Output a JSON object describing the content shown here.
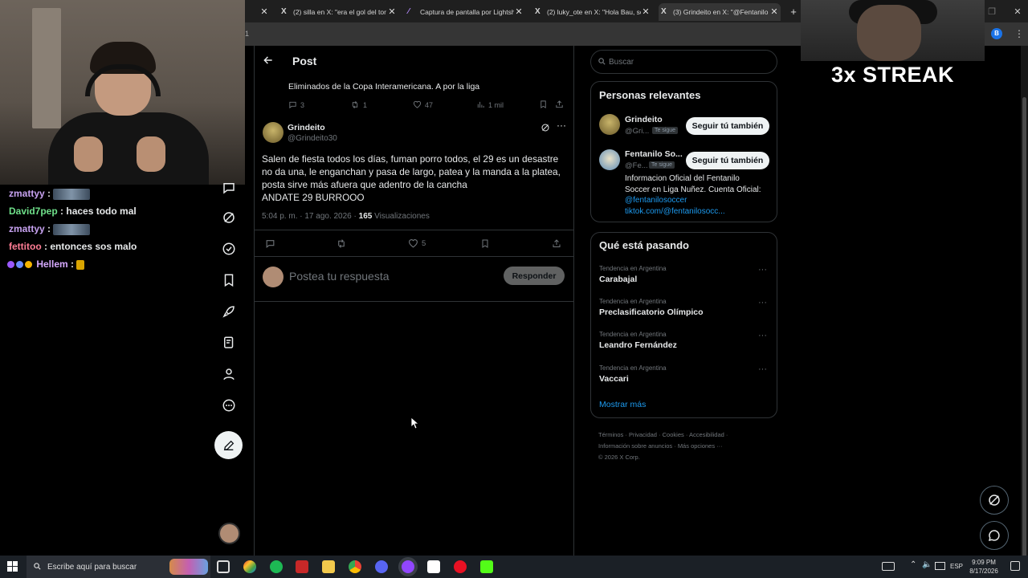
{
  "webcam": {
    "label": "Streamer webcam"
  },
  "chat": [
    {
      "user": "zmattyy",
      "color": "#c7a2f0",
      "message": "",
      "emote": "emote"
    },
    {
      "user": "David7pep",
      "color": "#6fe08a",
      "message": "haces todo mal"
    },
    {
      "user": "zmattyy",
      "color": "#c7a2f0",
      "message": "",
      "emote": "emote"
    },
    {
      "user": "fettitoo",
      "color": "#ff7d95",
      "message": "entonces sos malo"
    },
    {
      "user": "Hellem",
      "color": "#d6a9ff",
      "message": "",
      "badges": true
    }
  ],
  "browser": {
    "tabs": [
      {
        "title": "(2) silla en X: \"era el gol del tor"
      },
      {
        "title": "Captura de pantalla por Lightsh"
      },
      {
        "title": "(2) luky_ote en X: \"Hola Bau, so"
      },
      {
        "title": "(3) Grindeito en X: \"@Fentanilo"
      }
    ],
    "address_fragment": "1",
    "profile_initial": "B"
  },
  "overlay": {
    "streak": "3x STREAK"
  },
  "x": {
    "header_title": "Post",
    "parent_post": {
      "text": "Eliminados de la Copa Interamericana.  A por la liga",
      "replies": "3",
      "reposts": "1",
      "likes": "47",
      "views": "1 mil"
    },
    "post": {
      "author_name": "Grindeito",
      "author_handle": "@Grindeito30",
      "lines": [
        "Salen de fiesta todos los días, fuman porro todos, el 29 es un desastre",
        "no da una, le enganchan y pasa de largo, patea y la manda a la platea,",
        "posta sirve más afuera que adentro de la cancha",
        "ANDATE 29 BURROOO"
      ],
      "time": "5:04 p. m. · 17 ago. 2026 · ",
      "views_count": "165",
      "views_label": "Visualizaciones",
      "likes": "5"
    },
    "reply_placeholder": "Postea tu respuesta",
    "reply_button": "Responder",
    "search_placeholder": "Buscar",
    "relevant": {
      "title": "Personas relevantes",
      "people": [
        {
          "name": "Grindeito",
          "handle": "@Gri...",
          "follows_you": "Te sigue",
          "button": "Seguir tú también"
        },
        {
          "name": "Fentanilo So...",
          "handle": "@Fe...",
          "follows_you": "Te sigue",
          "button": "Seguir tú también",
          "bio1": "Informacion Oficial del Fentanilo",
          "bio2": "Soccer en Liga Nuñez. Cuenta Oficial:",
          "link1": "@fentanilosoccer",
          "link2": "tiktok.com/@fentanilosocc..."
        }
      ]
    },
    "trends": {
      "title": "Qué está pasando",
      "items": [
        {
          "context": "Tendencia en Argentina",
          "name": "Carabajal"
        },
        {
          "context": "Tendencia en Argentina",
          "name": "Preclasificatorio Olímpico"
        },
        {
          "context": "Tendencia en Argentina",
          "name": "Leandro Fernández"
        },
        {
          "context": "Tendencia en Argentina",
          "name": "Vaccari"
        }
      ],
      "show_more": "Mostrar más"
    },
    "footer": {
      "l1": [
        "Términos",
        "Privacidad",
        "Cookies",
        "Accesibilidad"
      ],
      "l2": [
        "Información sobre anuncios",
        "Más opciones ···"
      ],
      "copyright": "© 2026 X Corp."
    }
  },
  "taskbar": {
    "search_placeholder": "Escribe aquí para buscar",
    "lang": "ESP",
    "time": "9:09 PM",
    "date": "8/17/2026"
  }
}
